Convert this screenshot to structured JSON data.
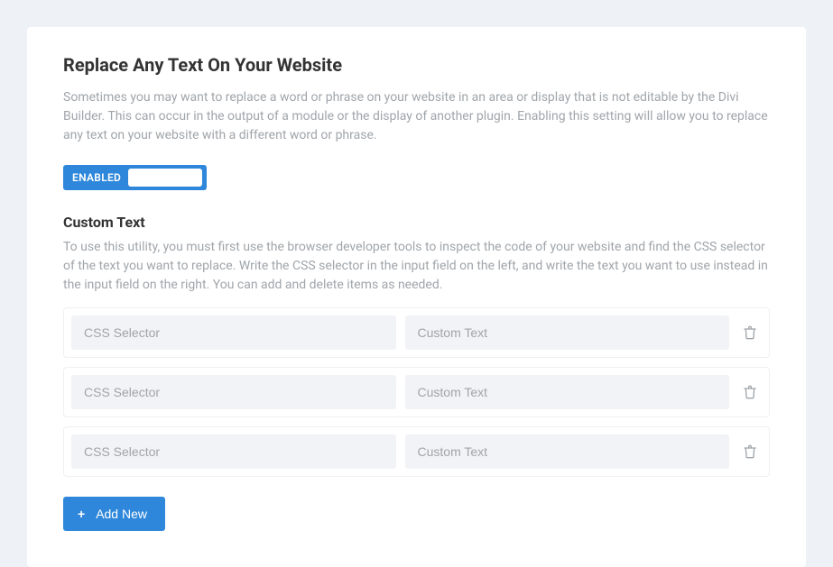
{
  "main": {
    "title": "Replace Any Text On Your Website",
    "description": "Sometimes you may want to replace a word or phrase on your website in an area or display that is not editable by the Divi Builder. This can occur in the output of a module or the display of another plugin. Enabling this setting will allow you to replace any text on your website with a different word or phrase.",
    "toggle": {
      "label": "ENABLED",
      "state": "on"
    },
    "custom": {
      "title": "Custom Text",
      "description": "To use this utility, you must first use the browser developer tools to inspect the code of your website and find the CSS selector of the text you want to replace. Write the CSS selector in the input field on the left, and write the text you want to use instead in the input field on the right. You can add and delete items as needed.",
      "rows": [
        {
          "selector_placeholder": "CSS Selector",
          "text_placeholder": "Custom Text",
          "selector_value": "",
          "text_value": ""
        },
        {
          "selector_placeholder": "CSS Selector",
          "text_placeholder": "Custom Text",
          "selector_value": "",
          "text_value": ""
        },
        {
          "selector_placeholder": "CSS Selector",
          "text_placeholder": "Custom Text",
          "selector_value": "",
          "text_value": ""
        }
      ],
      "add_button": {
        "plus": "+",
        "label": "Add New"
      }
    }
  }
}
